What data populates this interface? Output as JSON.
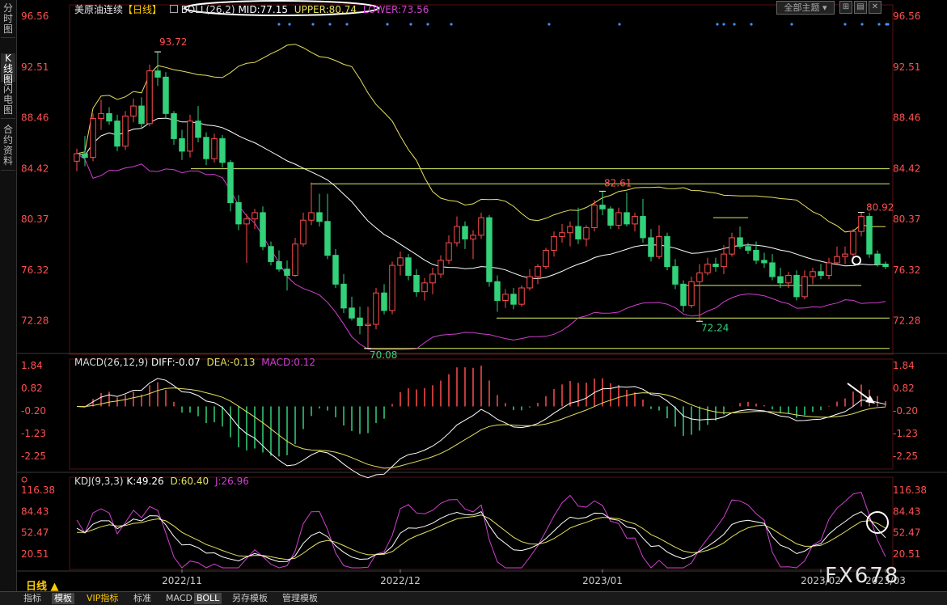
{
  "left_tabs": [
    "分时图",
    "K线图",
    "闪电图",
    "合约资料"
  ],
  "header": {
    "symbol": "美原油连续",
    "period": "【日线】",
    "boll_label": "BOLL(26,2)",
    "mid": "MID:77.15",
    "upper": "UPPER:80.74",
    "lower": "LOWER:73.56",
    "theme": "全部主题"
  },
  "macd_header": {
    "label": "MACD(26,12,9)",
    "diff": "DIFF:-0.07",
    "dea": "DEA:-0.13",
    "macd": "MACD:0.12"
  },
  "kdj_header": {
    "label": "KDJ(9,3,3)",
    "k": "K:49.26",
    "d": "D:60.40",
    "j": "J:26.96"
  },
  "price_axis": [
    "96.56",
    "92.51",
    "88.46",
    "84.42",
    "80.37",
    "76.32",
    "72.28"
  ],
  "macd_axis": [
    "1.84",
    "0.82",
    "-0.20",
    "-1.23",
    "-2.25"
  ],
  "kdj_axis": [
    "116.38",
    "84.43",
    "52.47",
    "20.51"
  ],
  "x_axis": [
    "2022/11",
    "2022/12",
    "2023/01",
    "2023/02",
    "2023/03"
  ],
  "annotations": {
    "high": "93.72",
    "low": "70.08",
    "mid_high": "82.61",
    "mid_low": "72.24",
    "recent_high": "80.92"
  },
  "period_label": "日线 ▲",
  "bottom_tabs": [
    "指标",
    "模板",
    "VIP指标",
    "标准",
    "MACD",
    "BOLL",
    "另存模板",
    "管理模板"
  ],
  "watermark": "FX678",
  "colors": {
    "up": "#ff4d4d",
    "down": "#33d17a",
    "upper": "#e6e060",
    "mid": "#ffffff",
    "lower": "#d040d0",
    "level": "#d8f060"
  },
  "chart_data": {
    "type": "candlestick",
    "title": "美原油连续",
    "ylim": [
      70.0,
      96.56
    ],
    "candles": [
      [
        85.0,
        86.0,
        84.2,
        85.6
      ],
      [
        85.6,
        87.0,
        84.6,
        85.3
      ],
      [
        85.3,
        88.8,
        85.0,
        88.4
      ],
      [
        88.4,
        89.9,
        87.5,
        88.8
      ],
      [
        88.8,
        89.3,
        87.9,
        88.2
      ],
      [
        88.2,
        88.7,
        85.8,
        86.2
      ],
      [
        86.2,
        89.0,
        85.9,
        88.6
      ],
      [
        88.6,
        90.0,
        88.1,
        89.4
      ],
      [
        89.4,
        90.1,
        87.6,
        88.0
      ],
      [
        88.0,
        92.7,
        87.8,
        92.2
      ],
      [
        92.2,
        93.72,
        91.0,
        91.7
      ],
      [
        91.7,
        92.1,
        88.4,
        88.8
      ],
      [
        88.8,
        89.0,
        86.3,
        86.8
      ],
      [
        86.8,
        87.5,
        85.1,
        85.8
      ],
      [
        85.8,
        88.7,
        85.3,
        88.2
      ],
      [
        88.2,
        89.4,
        86.5,
        86.9
      ],
      [
        86.9,
        87.3,
        84.7,
        85.2
      ],
      [
        85.2,
        87.2,
        84.9,
        86.8
      ],
      [
        86.8,
        87.1,
        84.5,
        84.9
      ],
      [
        84.9,
        85.1,
        81.0,
        81.7
      ],
      [
        81.7,
        82.3,
        79.5,
        80.0
      ],
      [
        80.0,
        80.8,
        76.9,
        80.4
      ],
      [
        80.4,
        81.2,
        79.6,
        80.9
      ],
      [
        80.9,
        81.4,
        77.9,
        78.2
      ],
      [
        78.2,
        78.6,
        76.7,
        77.0
      ],
      [
        77.0,
        77.9,
        76.2,
        76.4
      ],
      [
        76.4,
        77.1,
        74.7,
        75.9
      ],
      [
        75.9,
        78.9,
        75.8,
        78.4
      ],
      [
        78.4,
        80.9,
        78.2,
        80.3
      ],
      [
        80.3,
        83.3,
        79.9,
        80.9
      ],
      [
        80.9,
        82.4,
        79.8,
        80.2
      ],
      [
        80.2,
        82.4,
        77.2,
        77.5
      ],
      [
        77.5,
        78.0,
        74.9,
        75.2
      ],
      [
        75.2,
        76.0,
        72.9,
        73.3
      ],
      [
        73.3,
        74.2,
        72.3,
        72.5
      ],
      [
        72.5,
        73.4,
        71.2,
        71.9
      ],
      [
        71.9,
        73.4,
        70.08,
        72.0
      ],
      [
        72.0,
        74.9,
        71.6,
        74.5
      ],
      [
        74.5,
        75.2,
        72.8,
        73.1
      ],
      [
        73.1,
        77.0,
        72.8,
        76.7
      ],
      [
        76.7,
        77.8,
        75.9,
        77.3
      ],
      [
        77.3,
        77.6,
        75.5,
        75.9
      ],
      [
        75.9,
        76.4,
        74.2,
        74.6
      ],
      [
        74.6,
        75.7,
        73.9,
        75.3
      ],
      [
        75.3,
        76.5,
        74.4,
        76.0
      ],
      [
        76.0,
        77.5,
        75.7,
        77.1
      ],
      [
        77.1,
        79.1,
        76.8,
        78.5
      ],
      [
        78.5,
        80.6,
        78.2,
        79.8
      ],
      [
        79.8,
        80.2,
        78.0,
        78.8
      ],
      [
        78.8,
        79.5,
        77.2,
        79.1
      ],
      [
        79.1,
        80.9,
        78.8,
        80.5
      ],
      [
        80.5,
        80.7,
        75.0,
        75.4
      ],
      [
        75.4,
        75.9,
        73.0,
        73.9
      ],
      [
        73.9,
        74.8,
        73.3,
        74.4
      ],
      [
        74.4,
        74.9,
        73.2,
        73.6
      ],
      [
        73.6,
        75.1,
        73.4,
        74.9
      ],
      [
        74.9,
        76.4,
        74.7,
        75.8
      ],
      [
        75.8,
        76.8,
        75.2,
        76.6
      ],
      [
        76.6,
        78.1,
        76.4,
        77.9
      ],
      [
        77.9,
        79.4,
        77.4,
        79.0
      ],
      [
        79.0,
        80.0,
        78.5,
        79.3
      ],
      [
        79.3,
        80.2,
        78.2,
        79.8
      ],
      [
        79.8,
        81.3,
        78.4,
        78.8
      ],
      [
        78.8,
        79.9,
        78.2,
        79.7
      ],
      [
        79.7,
        81.9,
        79.4,
        81.5
      ],
      [
        81.5,
        82.61,
        80.7,
        81.2
      ],
      [
        81.2,
        81.4,
        79.6,
        79.9
      ],
      [
        79.9,
        81.3,
        79.6,
        80.9
      ],
      [
        80.9,
        82.5,
        79.8,
        80.0
      ],
      [
        80.0,
        80.9,
        79.4,
        80.6
      ],
      [
        80.6,
        82.0,
        78.5,
        78.9
      ],
      [
        78.9,
        79.6,
        77.0,
        77.4
      ],
      [
        77.4,
        79.9,
        77.2,
        79.0
      ],
      [
        79.0,
        79.3,
        76.3,
        76.6
      ],
      [
        76.6,
        77.2,
        74.8,
        75.2
      ],
      [
        75.2,
        75.5,
        73.0,
        73.5
      ],
      [
        73.5,
        75.8,
        73.3,
        75.4
      ],
      [
        75.4,
        76.8,
        72.24,
        76.1
      ],
      [
        76.1,
        77.3,
        75.9,
        76.8
      ],
      [
        76.8,
        77.3,
        76.2,
        76.6
      ],
      [
        76.6,
        78.3,
        76.0,
        77.6
      ],
      [
        77.6,
        79.3,
        77.4,
        78.9
      ],
      [
        78.9,
        79.8,
        78.0,
        78.2
      ],
      [
        78.2,
        78.5,
        77.6,
        77.9
      ],
      [
        77.9,
        78.6,
        76.8,
        77.1
      ],
      [
        77.1,
        77.7,
        76.5,
        76.9
      ],
      [
        76.9,
        77.6,
        75.5,
        75.8
      ],
      [
        75.8,
        76.5,
        74.9,
        75.3
      ],
      [
        75.3,
        76.2,
        74.9,
        75.9
      ],
      [
        75.9,
        76.3,
        73.9,
        74.2
      ],
      [
        74.2,
        76.3,
        74.0,
        75.8
      ],
      [
        75.8,
        76.5,
        75.2,
        76.2
      ],
      [
        76.2,
        76.8,
        75.6,
        75.9
      ],
      [
        75.9,
        77.3,
        75.6,
        76.9
      ],
      [
        76.9,
        78.2,
        76.7,
        77.4
      ],
      [
        77.4,
        78.2,
        76.8,
        77.6
      ],
      [
        77.6,
        79.6,
        77.1,
        79.4
      ],
      [
        79.4,
        80.92,
        79.0,
        80.6
      ],
      [
        80.6,
        80.9,
        77.3,
        77.6
      ],
      [
        77.6,
        77.9,
        76.6,
        76.8
      ],
      [
        76.8,
        77.0,
        76.4,
        76.6
      ]
    ],
    "boll_current": {
      "mid": 77.15,
      "upper": 80.74,
      "lower": 73.56
    },
    "macd_current": {
      "diff": -0.07,
      "dea": -0.13,
      "macd": 0.12
    },
    "kdj_current": {
      "k": 49.26,
      "d": 60.4,
      "j": 26.96
    },
    "levels": [
      84.4,
      83.2,
      80.5,
      75.1,
      72.5,
      70.08
    ],
    "x_tick_index": [
      13,
      40,
      65,
      92,
      119
    ]
  }
}
